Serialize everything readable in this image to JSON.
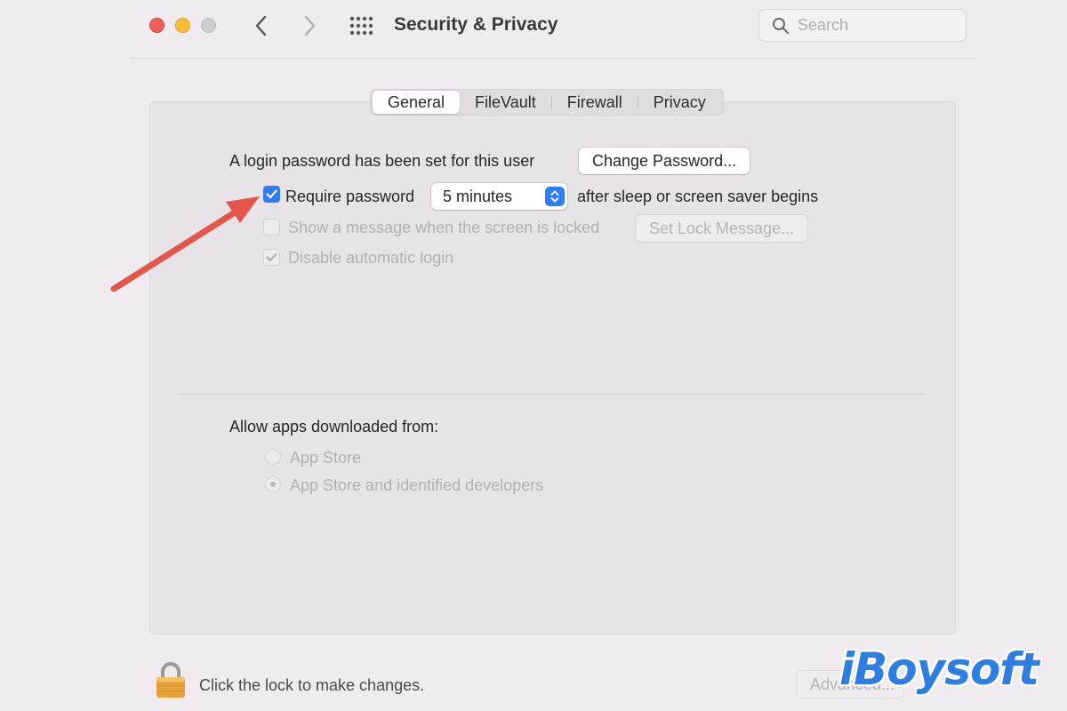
{
  "window": {
    "title": "Security & Privacy",
    "search_placeholder": "Search"
  },
  "tabs": [
    {
      "label": "General",
      "active": true
    },
    {
      "label": "FileVault",
      "active": false
    },
    {
      "label": "Firewall",
      "active": false
    },
    {
      "label": "Privacy",
      "active": false
    }
  ],
  "general": {
    "login_password_text": "A login password has been set for this user",
    "change_password_label": "Change Password...",
    "require_password": {
      "label": "Require password",
      "checked": true,
      "delay_value": "5 minutes",
      "suffix": "after sleep or screen saver begins"
    },
    "show_message": {
      "label": "Show a message when the screen is locked",
      "checked": false,
      "enabled": false
    },
    "set_lock_message_label": "Set Lock Message...",
    "disable_auto_login": {
      "label": "Disable automatic login",
      "checked": true,
      "enabled": false
    },
    "allow_apps_label": "Allow apps downloaded from:",
    "allow_apps_options": [
      {
        "label": "App Store",
        "selected": false
      },
      {
        "label": "App Store and identified developers",
        "selected": true
      }
    ]
  },
  "footer": {
    "lock_text": "Click the lock to make changes.",
    "advanced_label": "Advanced..."
  },
  "watermark": "iBoysoft",
  "colors": {
    "accent": "#2f7cf6",
    "annotation_arrow": "#e5564a",
    "close": "#ed5f57",
    "minimize": "#f5bd3a",
    "watermark": "#2e7de0"
  }
}
